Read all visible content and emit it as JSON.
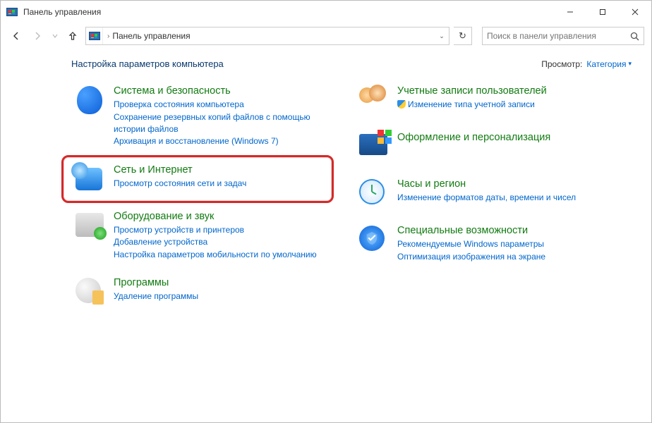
{
  "window": {
    "title": "Панель управления"
  },
  "toolbar": {
    "breadcrumb_root": "Панель управления",
    "search_placeholder": "Поиск в панели управления"
  },
  "header": {
    "heading": "Настройка параметров компьютера",
    "viewby_label": "Просмотр:",
    "viewby_value": "Категория"
  },
  "left": [
    {
      "title": "Система и безопасность",
      "links": [
        "Проверка состояния компьютера",
        "Сохранение резервных копий файлов с помощью истории файлов",
        "Архивация и восстановление (Windows 7)"
      ],
      "icon": "ic-shield"
    },
    {
      "title": "Сеть и Интернет",
      "links": [
        "Просмотр состояния сети и задач"
      ],
      "icon": "ic-net",
      "highlight": true
    },
    {
      "title": "Оборудование и звук",
      "links": [
        "Просмотр устройств и принтеров",
        "Добавление устройства",
        "Настройка параметров мобильности по умолчанию"
      ],
      "icon": "ic-hw"
    },
    {
      "title": "Программы",
      "links": [
        "Удаление программы"
      ],
      "icon": "ic-prog"
    }
  ],
  "right": [
    {
      "title": "Учетные записи пользователей",
      "links": [
        "Изменение типа учетной записи"
      ],
      "icon": "ic-users",
      "shield_on_links": [
        0
      ]
    },
    {
      "title": "Оформление и персонализация",
      "links": [],
      "icon": "ic-pers"
    },
    {
      "title": "Часы и регион",
      "links": [
        "Изменение форматов даты, времени и чисел"
      ],
      "icon": "ic-clock"
    },
    {
      "title": "Специальные возможности",
      "links": [
        "Рекомендуемые Windows параметры",
        "Оптимизация изображения на экране"
      ],
      "icon": "ic-acc"
    }
  ]
}
